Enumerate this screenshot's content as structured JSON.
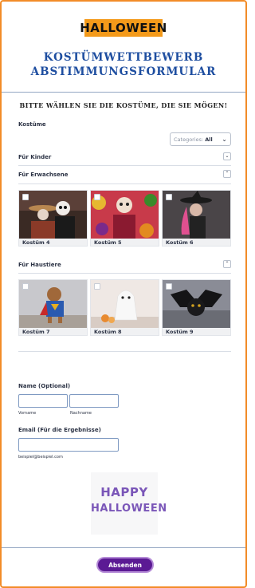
{
  "logo_text": "HALLOWEEN",
  "title_line1": "KOSTÜMWETTBEWERB",
  "title_line2": "ABSTIMMUNGSFORMULAR",
  "instruction": "BITTE WÄHLEN SIE DIE KOSTÜME, DIE SIE MÖGEN!",
  "costumes_label": "Kostüme",
  "category_select": {
    "prefix": "Categories:",
    "value": "All"
  },
  "sections": [
    {
      "title": "Für Kinder",
      "toggle": "⌄"
    },
    {
      "title": "Für Erwachsene",
      "toggle": "⌃"
    },
    {
      "title": "Für Haustiere",
      "toggle": "⌃"
    }
  ],
  "adult_cards": [
    "Kostüm 4",
    "Kostüm 5",
    "Kostüm 6"
  ],
  "pet_cards": [
    "Kostüm 7",
    "Kostüm 8",
    "Kostüm 9"
  ],
  "name_field": {
    "label": "Name (Optional)",
    "first_sub": "Vorname",
    "last_sub": "Nachname"
  },
  "email_field": {
    "label": "Email (Für die Ergebnisse)",
    "sub": "beispiel@beispiel.com"
  },
  "happy_halloween": {
    "line1": "HAPPY",
    "line2": "HALLOWEEN"
  },
  "submit_label": "Absenden",
  "colors": {
    "border": "#f28c28",
    "title": "#1e4ea0",
    "submit": "#5b1a94",
    "logo_bg": "#f49a1a"
  }
}
